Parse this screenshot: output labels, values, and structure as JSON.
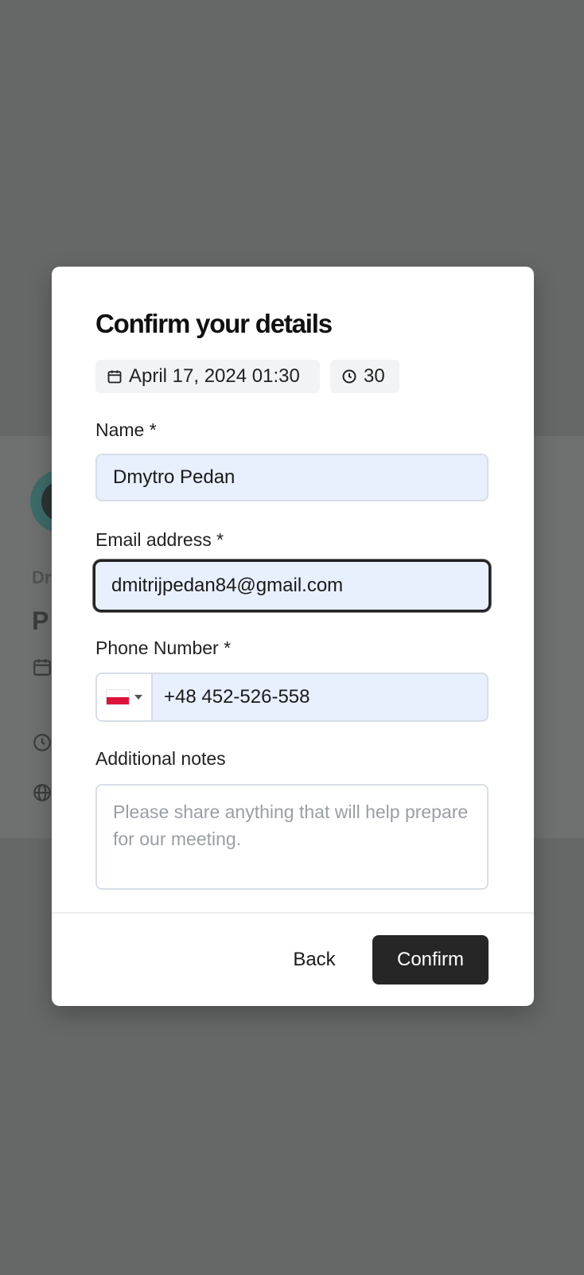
{
  "background": {
    "host_initials": "Dr",
    "event_initial": "P"
  },
  "modal": {
    "title": "Confirm your details",
    "date_chip": "April 17, 2024 01:30",
    "duration_chip": "30",
    "fields": {
      "name": {
        "label": "Name *",
        "value": "Dmytro Pedan"
      },
      "email": {
        "label": "Email address *",
        "value": "dmitrijpedan84@gmail.com"
      },
      "phone": {
        "label": "Phone Number *",
        "value": "+48 452-526-558",
        "country": "Poland"
      },
      "notes": {
        "label": "Additional notes",
        "placeholder": "Please share anything that will help prepare for our meeting."
      }
    },
    "actions": {
      "back": "Back",
      "confirm": "Confirm"
    }
  },
  "colors": {
    "overlay": "#666868",
    "input_bg": "#e8effd",
    "confirm_bg": "#262626"
  }
}
